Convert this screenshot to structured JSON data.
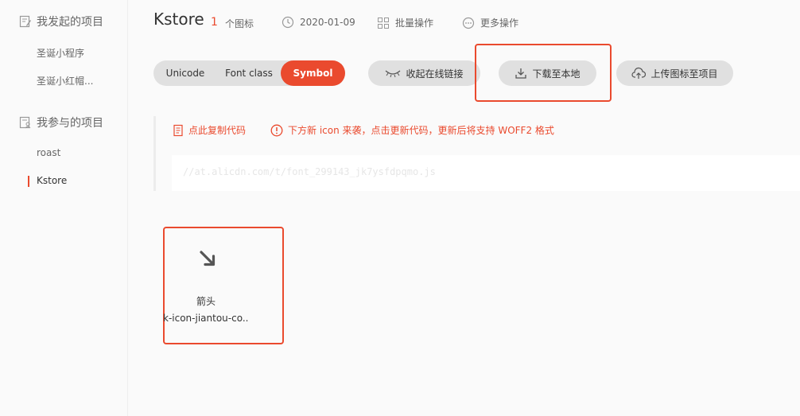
{
  "sidebar": {
    "my_projects_title": "我发起的项目",
    "my_projects": [
      "圣诞小程序",
      "圣诞小红帽..."
    ],
    "joined_projects_title": "我参与的项目",
    "joined_projects": [
      "roast",
      "Kstore"
    ],
    "active_item": "Kstore"
  },
  "header": {
    "project_name": "Kstore",
    "icon_count": "1",
    "icon_count_label": "个图标",
    "date": "2020-01-09",
    "batch_label": "批量操作",
    "more_label": "更多操作"
  },
  "tabs": {
    "items": [
      "Unicode",
      "Font class",
      "Symbol"
    ],
    "active": "Symbol"
  },
  "actions": {
    "collapse_link": "收起在线链接",
    "download": "下载至本地",
    "upload": "上传图标至项目"
  },
  "code_panel": {
    "copy_label": "点此复制代码",
    "notice": "下方新 icon 来袭，点击更新代码，更新后将支持 WOFF2 格式",
    "code": "//at.alicdn.com/t/font_299143_jk7ysfdpqmo.js"
  },
  "icons": [
    {
      "name": "箭头",
      "code": "k-icon-jiantou-co..."
    }
  ],
  "colors": {
    "accent": "#ea4a2e",
    "button_bg": "#e0e0e0"
  }
}
